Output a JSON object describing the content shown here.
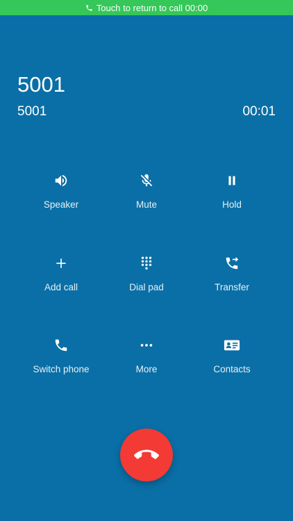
{
  "return_bar": {
    "text": "Touch to return to call 00:00",
    "icon": "phone-icon",
    "color": "#35c759"
  },
  "caller": {
    "name": "5001",
    "number": "5001",
    "duration": "00:01"
  },
  "controls": [
    {
      "label": "Speaker",
      "icon": "speaker-icon"
    },
    {
      "label": "Mute",
      "icon": "mic-off-icon"
    },
    {
      "label": "Hold",
      "icon": "pause-icon"
    },
    {
      "label": "Add call",
      "icon": "plus-icon"
    },
    {
      "label": "Dial pad",
      "icon": "dialpad-icon"
    },
    {
      "label": "Transfer",
      "icon": "transfer-icon"
    },
    {
      "label": "Switch phone",
      "icon": "phone-icon"
    },
    {
      "label": "More",
      "icon": "more-icon"
    },
    {
      "label": "Contacts",
      "icon": "contacts-card-icon"
    }
  ],
  "hangup": {
    "icon": "hangup-icon",
    "color": "#f33a34"
  },
  "colors": {
    "background": "#0a6fa6",
    "text": "#ffffff"
  }
}
